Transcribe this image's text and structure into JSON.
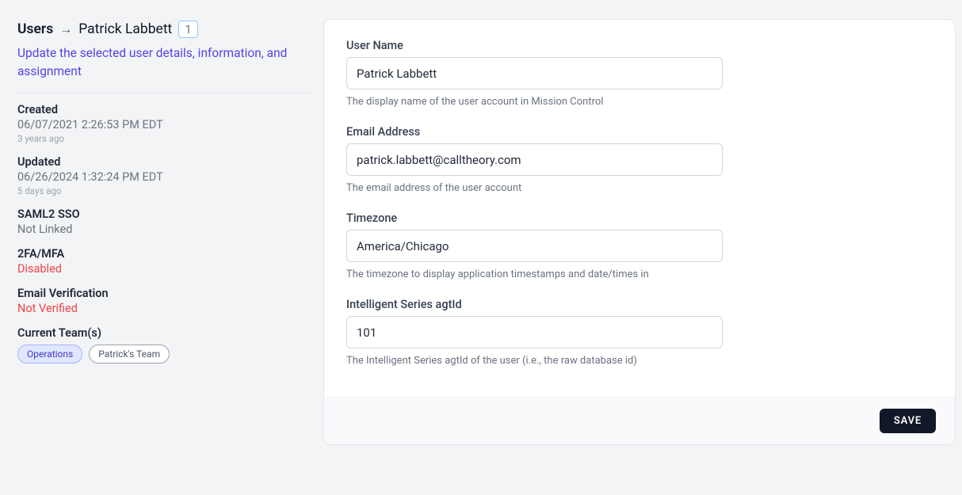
{
  "breadcrumb": {
    "root": "Users",
    "arrow": "→",
    "user_name": "Patrick Labbett",
    "user_id": "1"
  },
  "subtitle": "Update the selected user details, information, and assignment",
  "meta": {
    "created": {
      "label": "Created",
      "value": "06/07/2021 2:26:53 PM EDT",
      "ago": "3 years ago"
    },
    "updated": {
      "label": "Updated",
      "value": "06/26/2024 1:32:24 PM EDT",
      "ago": "5 days ago"
    },
    "saml": {
      "label": "SAML2 SSO",
      "value": "Not Linked"
    },
    "mfa": {
      "label": "2FA/MFA",
      "value": "Disabled"
    },
    "email_verification": {
      "label": "Email Verification",
      "value": "Not Verified"
    },
    "teams": {
      "label": "Current Team(s)",
      "items": [
        "Operations",
        "Patrick's Team"
      ]
    }
  },
  "form": {
    "user_name": {
      "label": "User Name",
      "value": "Patrick Labbett",
      "help": "The display name of the user account in Mission Control"
    },
    "email": {
      "label": "Email Address",
      "value": "patrick.labbett@calltheory.com",
      "help": "The email address of the user account"
    },
    "timezone": {
      "label": "Timezone",
      "value": "America/Chicago",
      "help": "The timezone to display application timestamps and date/times in"
    },
    "agtid": {
      "label": "Intelligent Series agtId",
      "value": "101",
      "help": "The Intelligent Series agtId of the user (i.e., the raw database id)"
    },
    "save_label": "SAVE"
  }
}
